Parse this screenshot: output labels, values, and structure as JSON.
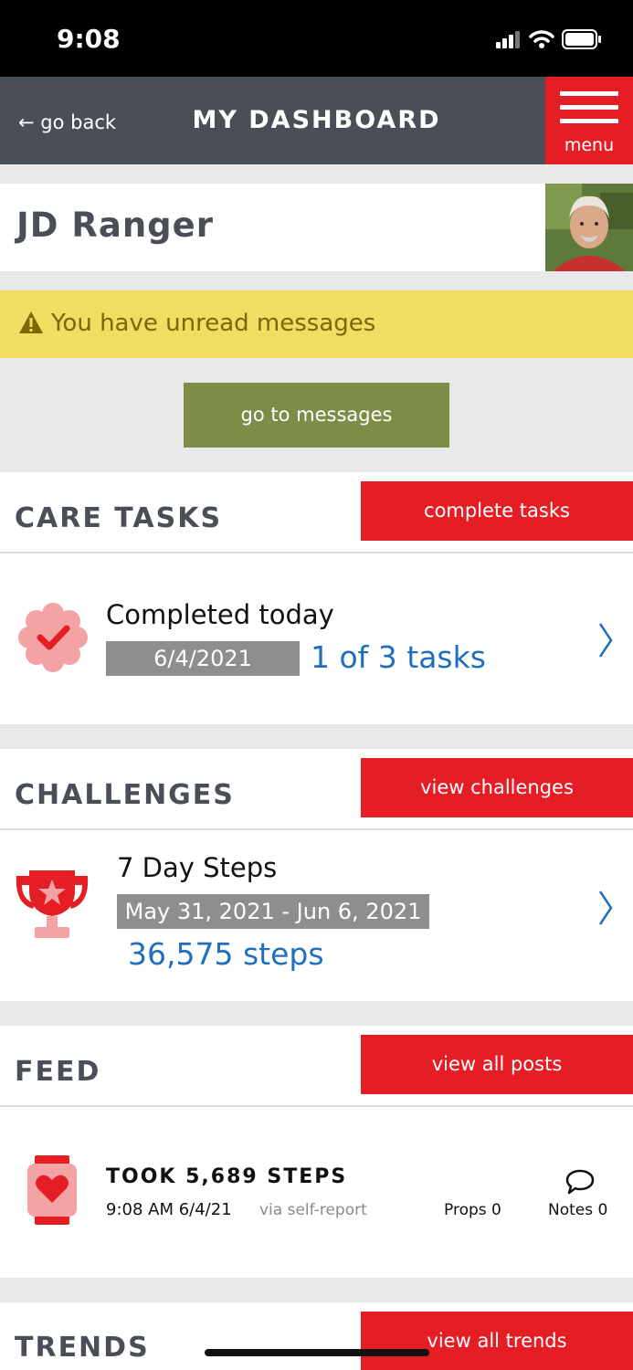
{
  "status_bar": {
    "time": "9:08"
  },
  "header": {
    "back_label": "← go back",
    "title": "MY DASHBOARD",
    "menu_label": "menu"
  },
  "profile": {
    "name": "JD Ranger"
  },
  "alert": {
    "text": "You have unread messages",
    "button_label": "go to messages"
  },
  "care_tasks": {
    "title": "CARE TASKS",
    "button_label": "complete tasks",
    "heading": "Completed today",
    "date": "6/4/2021",
    "progress": "1 of 3 tasks"
  },
  "challenges": {
    "title": "CHALLENGES",
    "button_label": "view challenges",
    "name": "7 Day Steps",
    "date_range": "May 31, 2021 - Jun 6, 2021",
    "steps": "36,575 steps"
  },
  "feed": {
    "title": "FEED",
    "button_label": "view all posts",
    "post": {
      "title": "TOOK 5,689 STEPS",
      "timestamp": "9:08 AM 6/4/21",
      "source": "via self-report",
      "props": "Props 0",
      "notes": "Notes 0"
    }
  },
  "trends": {
    "title": "TRENDS",
    "button_label": "view all trends"
  },
  "colors": {
    "accent_red": "#e51e25",
    "header_gray": "#4a4e57",
    "alert_yellow": "#f3dc62",
    "olive_button": "#7d8c47",
    "link_blue": "#1f6fbd"
  }
}
